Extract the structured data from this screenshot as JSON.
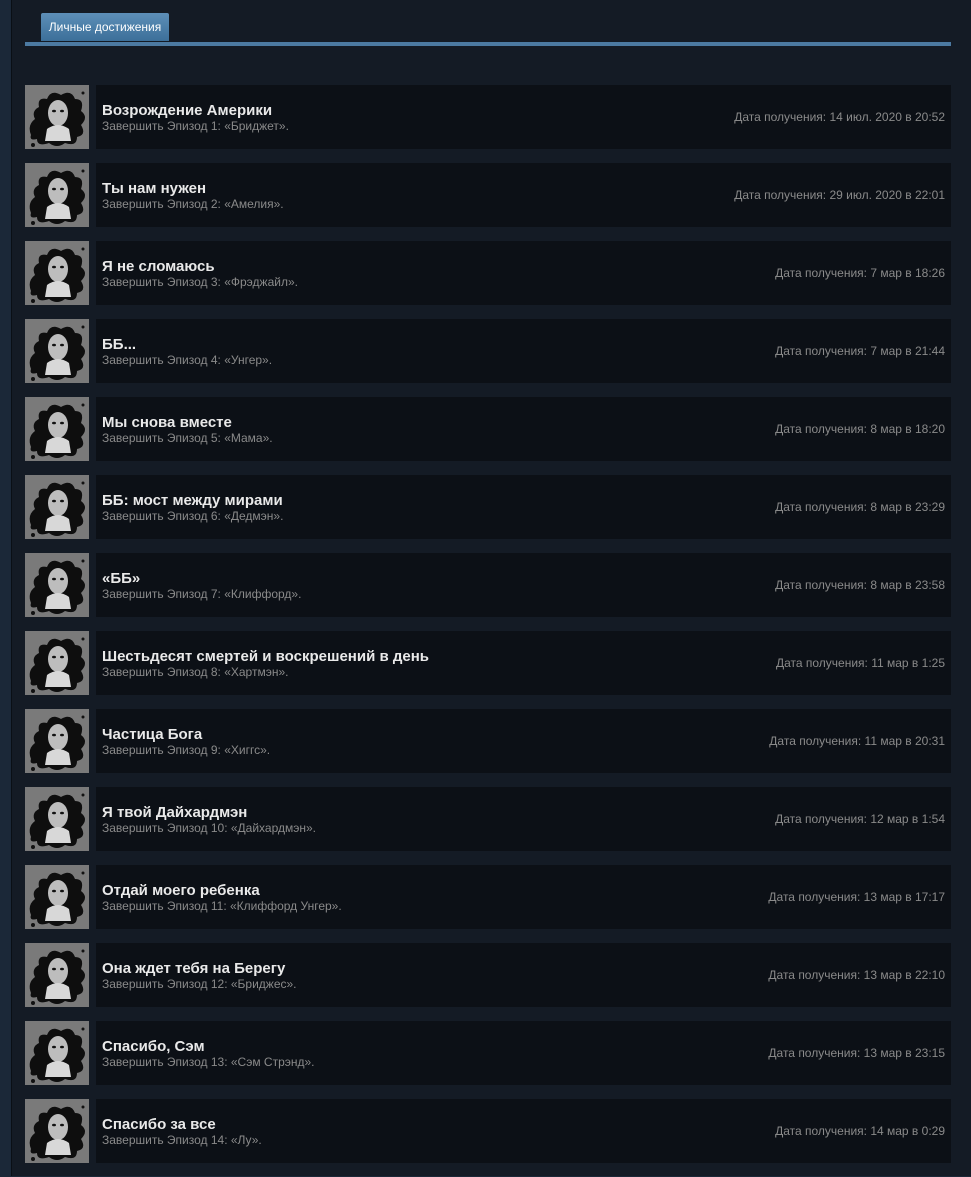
{
  "tab": {
    "label": "Личные достижения"
  },
  "achievements": [
    {
      "title": "Возрождение Америки",
      "desc": "Завершить Эпизод 1: «Бриджет».",
      "date": "Дата получения: 14 июл. 2020 в 20:52",
      "icon": "bridget-portrait-icon"
    },
    {
      "title": "Ты нам нужен",
      "desc": "Завершить Эпизод 2: «Амелия».",
      "date": "Дата получения: 29 июл. 2020 в 22:01",
      "icon": "amelie-portrait-icon"
    },
    {
      "title": "Я не сломаюсь",
      "desc": "Завершить Эпизод 3: «Фрэджайл».",
      "date": "Дата получения: 7 мар в 18:26",
      "icon": "fragile-portrait-icon"
    },
    {
      "title": "ББ...",
      "desc": "Завершить Эпизод 4: «Унгер».",
      "date": "Дата получения: 7 мар в 21:44",
      "icon": "unger-portrait-icon"
    },
    {
      "title": "Мы снова вместе",
      "desc": "Завершить Эпизод 5: «Мама».",
      "date": "Дата получения: 8 мар в 18:20",
      "icon": "mama-portrait-icon"
    },
    {
      "title": "ББ: мост между мирами",
      "desc": "Завершить Эпизод 6: «Дедмэн».",
      "date": "Дата получения: 8 мар в 23:29",
      "icon": "deadman-portrait-icon"
    },
    {
      "title": "«ББ»",
      "desc": "Завершить Эпизод 7: «Клиффорд».",
      "date": "Дата получения: 8 мар в 23:58",
      "icon": "bb-pod-icon"
    },
    {
      "title": "Шестьдесят смертей и воскрешений в день",
      "desc": "Завершить Эпизод 8: «Хартмэн».",
      "date": "Дата получения: 11 мар в 1:25",
      "icon": "heartman-portrait-icon"
    },
    {
      "title": "Частица Бога",
      "desc": "Завершить Эпизод 9: «Хиггс».",
      "date": "Дата получения: 11 мар в 20:31",
      "icon": "higgs-portrait-icon"
    },
    {
      "title": "Я твой Дайхардмэн",
      "desc": "Завершить Эпизод 10: «Дайхардмэн».",
      "date": "Дата получения: 12 мар в 1:54",
      "icon": "diehardman-portrait-icon"
    },
    {
      "title": "Отдай моего ребенка",
      "desc": "Завершить Эпизод 11: «Клиффорд Унгер».",
      "date": "Дата получения: 13 мар в 17:17",
      "icon": "cliff-portrait-icon"
    },
    {
      "title": "Она ждет тебя на Берегу",
      "desc": "Завершить Эпизод 12: «Бриджес».",
      "date": "Дата получения: 13 мар в 22:10",
      "icon": "bridges-logo-icon"
    },
    {
      "title": "Спасибо, Сэм",
      "desc": "Завершить Эпизод 13: «Сэм Стрэнд».",
      "date": "Дата получения: 13 мар в 23:15",
      "icon": "sam-portrait-icon"
    },
    {
      "title": "Спасибо за все",
      "desc": "Завершить Эпизод 14: «Лу».",
      "date": "Дата получения: 14 мар в 0:29",
      "icon": "lou-portrait-icon"
    }
  ]
}
